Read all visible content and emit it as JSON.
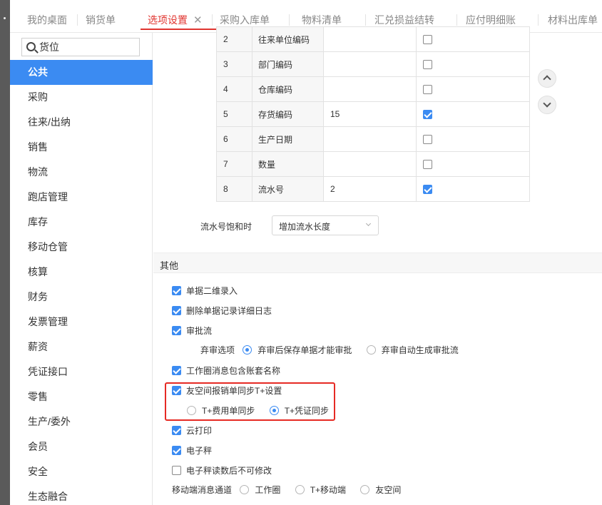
{
  "tabs": [
    {
      "label": "我的桌面"
    },
    {
      "label": "销货单"
    },
    {
      "label": "选项设置",
      "close": "✕"
    },
    {
      "label": "采购入库单"
    },
    {
      "label": "物料清单"
    },
    {
      "label": "汇兑损益结转"
    },
    {
      "label": "应付明细账"
    },
    {
      "label": "材料出库单"
    }
  ],
  "sidebar": {
    "search_value": "货位",
    "items": [
      "公共",
      "采购",
      "往来/出纳",
      "销售",
      "物流",
      "跑店管理",
      "库存",
      "移动仓管",
      "核算",
      "财务",
      "发票管理",
      "薪资",
      "凭证接口",
      "零售",
      "生产/委外",
      "会员",
      "安全",
      "生态融合"
    ]
  },
  "code_table": {
    "rows": [
      {
        "no": "2",
        "name": "往来单位编码",
        "length": "",
        "checked": false
      },
      {
        "no": "3",
        "name": "部门编码",
        "length": "",
        "checked": false
      },
      {
        "no": "4",
        "name": "仓库编码",
        "length": "",
        "checked": false
      },
      {
        "no": "5",
        "name": "存货编码",
        "length": "15",
        "checked": true
      },
      {
        "no": "6",
        "name": "生产日期",
        "length": "",
        "checked": false
      },
      {
        "no": "7",
        "name": "数量",
        "length": "",
        "checked": false
      },
      {
        "no": "8",
        "name": "流水号",
        "length": "2",
        "checked": true
      }
    ]
  },
  "serial_saturation": {
    "label": "流水号饱和时",
    "value": "增加流水长度"
  },
  "other": {
    "title": "其他",
    "opt_qr": "单据二维录入",
    "opt_delete_log": "删除单据记录详细日志",
    "opt_approval": "审批流",
    "abandon_label": "弃审选项",
    "abandon_opt1": "弃审后保存单据才能审批",
    "abandon_opt2": "弃审自动生成审批流",
    "opt_workcircle": "工作圈消息包含账套名称",
    "opt_sync": "友空间报销单同步T+设置",
    "sync_opt1": "T+费用单同步",
    "sync_opt2": "T+凭证同步",
    "opt_cloudprint": "云打印",
    "opt_scale": "电子秤",
    "opt_scale_readonly": "电子秤读数后不可修改",
    "mobile_label": "移动端消息通道",
    "mobile_opt1": "工作圈",
    "mobile_opt2": "T+移动端",
    "mobile_opt3": "友空间"
  },
  "colors": {
    "accent": "#3b8bf2",
    "active_tab": "#e0342f",
    "highlight": "#e62a24"
  }
}
